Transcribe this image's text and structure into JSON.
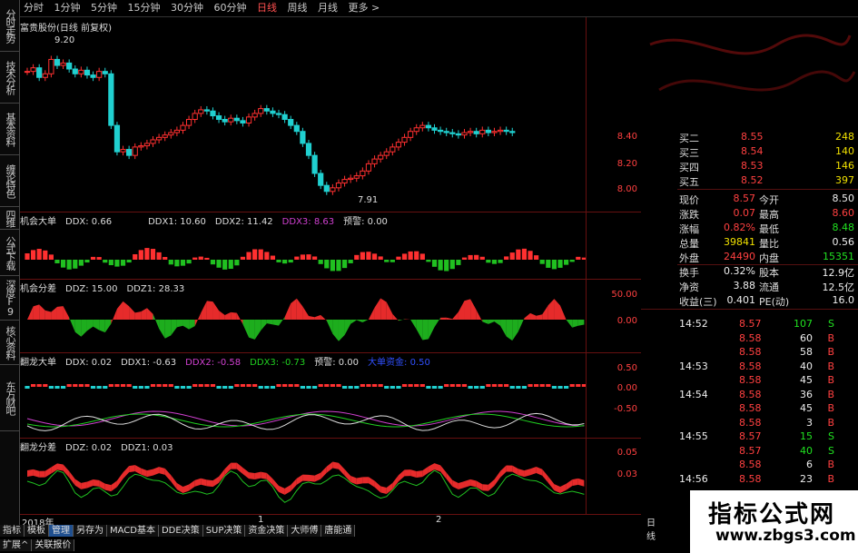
{
  "timeframes": [
    "分时",
    "1分钟",
    "5分钟",
    "15分钟",
    "30分钟",
    "60分钟",
    "日线",
    "周线",
    "月线",
    "更多 >"
  ],
  "active_timeframe": 6,
  "left_tabs": [
    "分时走势",
    "技术分析",
    "基本资料",
    "缠论特色",
    "四维",
    "公式下载",
    "深度F9",
    "核心资料",
    "东方财吧"
  ],
  "panel1": {
    "title": "富贵股份(日线 前复权)",
    "high_label": "9.20",
    "low_label": "7.91",
    "y_labels": [
      "8.40",
      "8.20",
      "8.00"
    ]
  },
  "panel2": {
    "label": "机会大单",
    "ddx": "DDX: 0.66",
    "ddx1": "DDX1: 10.60",
    "ddx2": "DDX2: 11.42",
    "ddx3": "DDX3: 8.63",
    "warn": "预警: 0.00"
  },
  "panel3": {
    "label": "机会分差",
    "ddz": "DDZ: 15.00",
    "ddz1": "DDZ1: 28.33",
    "y_labels": [
      "50.00",
      "0.00"
    ]
  },
  "panel4": {
    "label": "翻龙大单",
    "ddx": "DDX: 0.02",
    "ddx1": "DDX1: -0.63",
    "ddx2": "DDX2: -0.58",
    "ddx3": "DDX3: -0.73",
    "warn": "预警: 0.00",
    "extra": "大单资金: 0.50",
    "y_labels": [
      "0.50",
      "0.00",
      "-0.50"
    ]
  },
  "panel5": {
    "label": "翻龙分差",
    "ddz": "DDZ: 0.02",
    "ddz1": "DDZ1: 0.03",
    "y_labels": [
      "0.05",
      "0.03"
    ]
  },
  "date_axis": {
    "year": "2018年",
    "tick1": "1",
    "tick2": "2",
    "period": "日线"
  },
  "bottom_tabs": [
    "指标",
    "模板",
    "管理",
    "另存为",
    "MACD基本",
    "DDE决策",
    "SUP决策",
    "资金决策",
    "大师傅",
    "唐能通"
  ],
  "bottom_tabs2": [
    "扩展^",
    "关联报价"
  ],
  "order_book": [
    {
      "label": "买二",
      "price": "8.55",
      "vol": "248"
    },
    {
      "label": "买三",
      "price": "8.54",
      "vol": "140"
    },
    {
      "label": "买四",
      "price": "8.53",
      "vol": "146"
    },
    {
      "label": "买五",
      "price": "8.52",
      "vol": "397"
    }
  ],
  "quote": [
    {
      "l1": "现价",
      "v1": "8.57",
      "l2": "今开",
      "v2": "8.50"
    },
    {
      "l1": "涨跌",
      "v1": "0.07",
      "l2": "最高",
      "v2": "8.60"
    },
    {
      "l1": "涨幅",
      "v1": "0.82%",
      "l2": "最低",
      "v2": "8.48"
    },
    {
      "l1": "总量",
      "v1": "39841",
      "l2": "量比",
      "v2": "0.56"
    },
    {
      "l1": "外盘",
      "v1": "24490",
      "l2": "内盘",
      "v2": "15351"
    },
    {
      "l1": "换手",
      "v1": "0.32%",
      "l2": "股本",
      "v2": "12.9亿"
    },
    {
      "l1": "净资",
      "v1": "3.88",
      "l2": "流通",
      "v2": "12.5亿"
    },
    {
      "l1": "收益(三)",
      "v1": "0.401",
      "l2": "PE(动)",
      "v2": "16.0"
    }
  ],
  "ticks": [
    {
      "time": "14:52",
      "price": "8.57",
      "vol": "107",
      "side": "S"
    },
    {
      "time": "",
      "price": "8.58",
      "vol": "60",
      "side": "B"
    },
    {
      "time": "",
      "price": "8.58",
      "vol": "58",
      "side": "B"
    },
    {
      "time": "14:53",
      "price": "8.58",
      "vol": "40",
      "side": "B"
    },
    {
      "time": "",
      "price": "8.58",
      "vol": "45",
      "side": "B"
    },
    {
      "time": "14:54",
      "price": "8.58",
      "vol": "36",
      "side": "B"
    },
    {
      "time": "",
      "price": "8.58",
      "vol": "45",
      "side": "B"
    },
    {
      "time": "",
      "price": "8.58",
      "vol": "3",
      "side": "B"
    },
    {
      "time": "14:55",
      "price": "8.57",
      "vol": "15",
      "side": "S"
    },
    {
      "time": "",
      "price": "8.57",
      "vol": "40",
      "side": "S"
    },
    {
      "time": "",
      "price": "8.58",
      "vol": "6",
      "side": "B"
    },
    {
      "time": "14:56",
      "price": "8.58",
      "vol": "23",
      "side": "B"
    }
  ],
  "watermark": {
    "line1": "指标公式网",
    "line2": "www.zbgs3.com"
  },
  "colors": {
    "up": "#ff3030",
    "down": "#20d0d0",
    "green": "#20c020",
    "panel_border": "#661010"
  }
}
